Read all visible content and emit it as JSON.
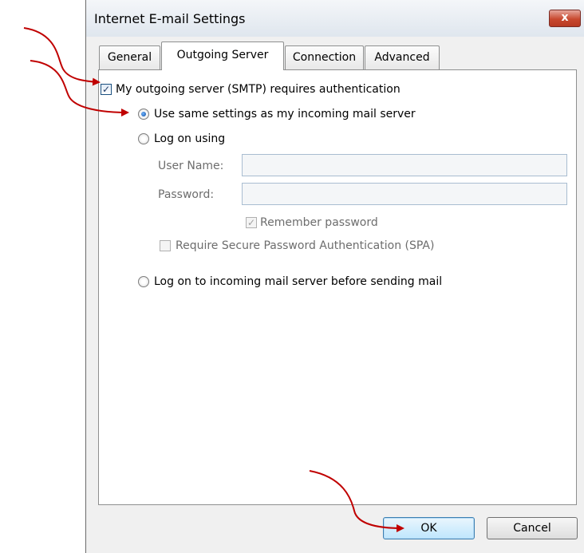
{
  "dialog": {
    "title": "Internet E-mail Settings",
    "close_label": "x",
    "tabs": [
      {
        "label": "General",
        "active": false
      },
      {
        "label": "Outgoing Server",
        "active": true
      },
      {
        "label": "Connection",
        "active": false
      },
      {
        "label": "Advanced",
        "active": false
      }
    ],
    "smtp_auth": {
      "label": "My outgoing server (SMTP) requires authentication",
      "checked": true
    },
    "options": {
      "same_settings": {
        "label": "Use same settings as my incoming mail server",
        "selected": true
      },
      "log_on_using": {
        "label": "Log on using",
        "selected": false
      },
      "log_on_incoming": {
        "label": "Log on to incoming mail server before sending mail",
        "selected": false
      }
    },
    "fields": {
      "username_label": "User Name:",
      "username_value": "",
      "password_label": "Password:",
      "password_value": ""
    },
    "remember_password": {
      "label": "Remember password",
      "checked": true
    },
    "require_spa": {
      "label": "Require Secure Password Authentication (SPA)",
      "checked": false
    },
    "buttons": {
      "ok": "OK",
      "cancel": "Cancel"
    },
    "annotation_color": "#c00000"
  }
}
